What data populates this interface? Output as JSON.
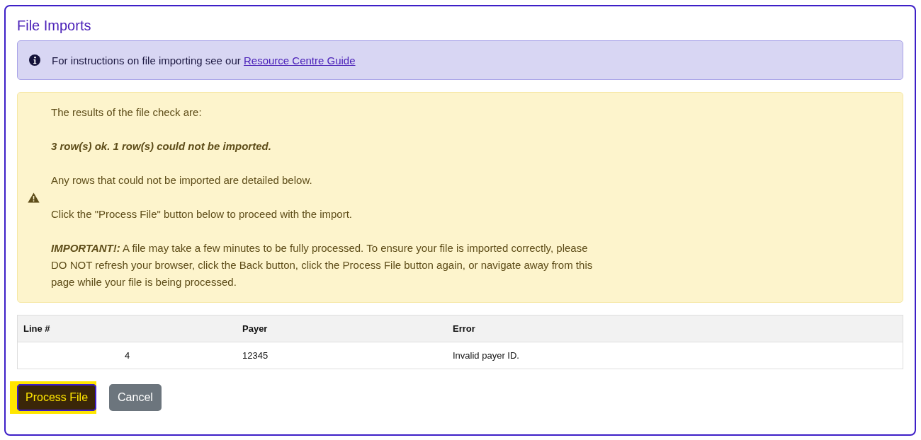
{
  "title": "File Imports",
  "info_alert": {
    "text": "For instructions on file importing see our ",
    "link": "Resource Centre Guide"
  },
  "warning_alert": {
    "paragraphs": [
      {
        "kind": "plain",
        "text": "The results of the file check are:"
      },
      {
        "kind": "emphasis",
        "text": "3 row(s) ok. 1 row(s) could not be imported."
      },
      {
        "kind": "plain",
        "text": "Any rows that could not be imported are detailed below."
      },
      {
        "kind": "plain",
        "text": "Click the \"Process File\" button below to proceed with the import."
      },
      {
        "kind": "plain",
        "text": "**IMPORTANT!:** A file may take a few minutes to be fully processed. To ensure your file is imported correctly, please DO NOT refresh your browser, click the Back button, click the Process File button again, or navigate away from this page while your file is being processed."
      }
    ]
  },
  "table": {
    "columns": [
      "Line #",
      "Payer",
      "Error"
    ],
    "rows": [
      [
        "4",
        "12345",
        "Invalid payer ID."
      ]
    ]
  },
  "buttons": [
    {
      "label": "Process File",
      "kind": "primary",
      "highlighted": true
    },
    {
      "label": "Cancel",
      "kind": "secondary",
      "highlighted": false
    }
  ]
}
